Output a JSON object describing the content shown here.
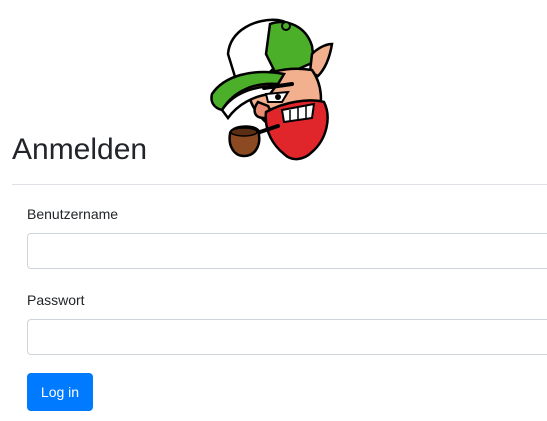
{
  "login": {
    "title": "Anmelden",
    "username_label": "Benutzername",
    "username_value": "",
    "password_label": "Passwort",
    "password_value": "",
    "submit_label": "Log in"
  },
  "colors": {
    "primary": "#007bff",
    "text": "#212529",
    "border": "#ced4da",
    "divider": "#dee2e6"
  },
  "icons": {
    "mascot": "leprechaun-mascot-logo"
  }
}
